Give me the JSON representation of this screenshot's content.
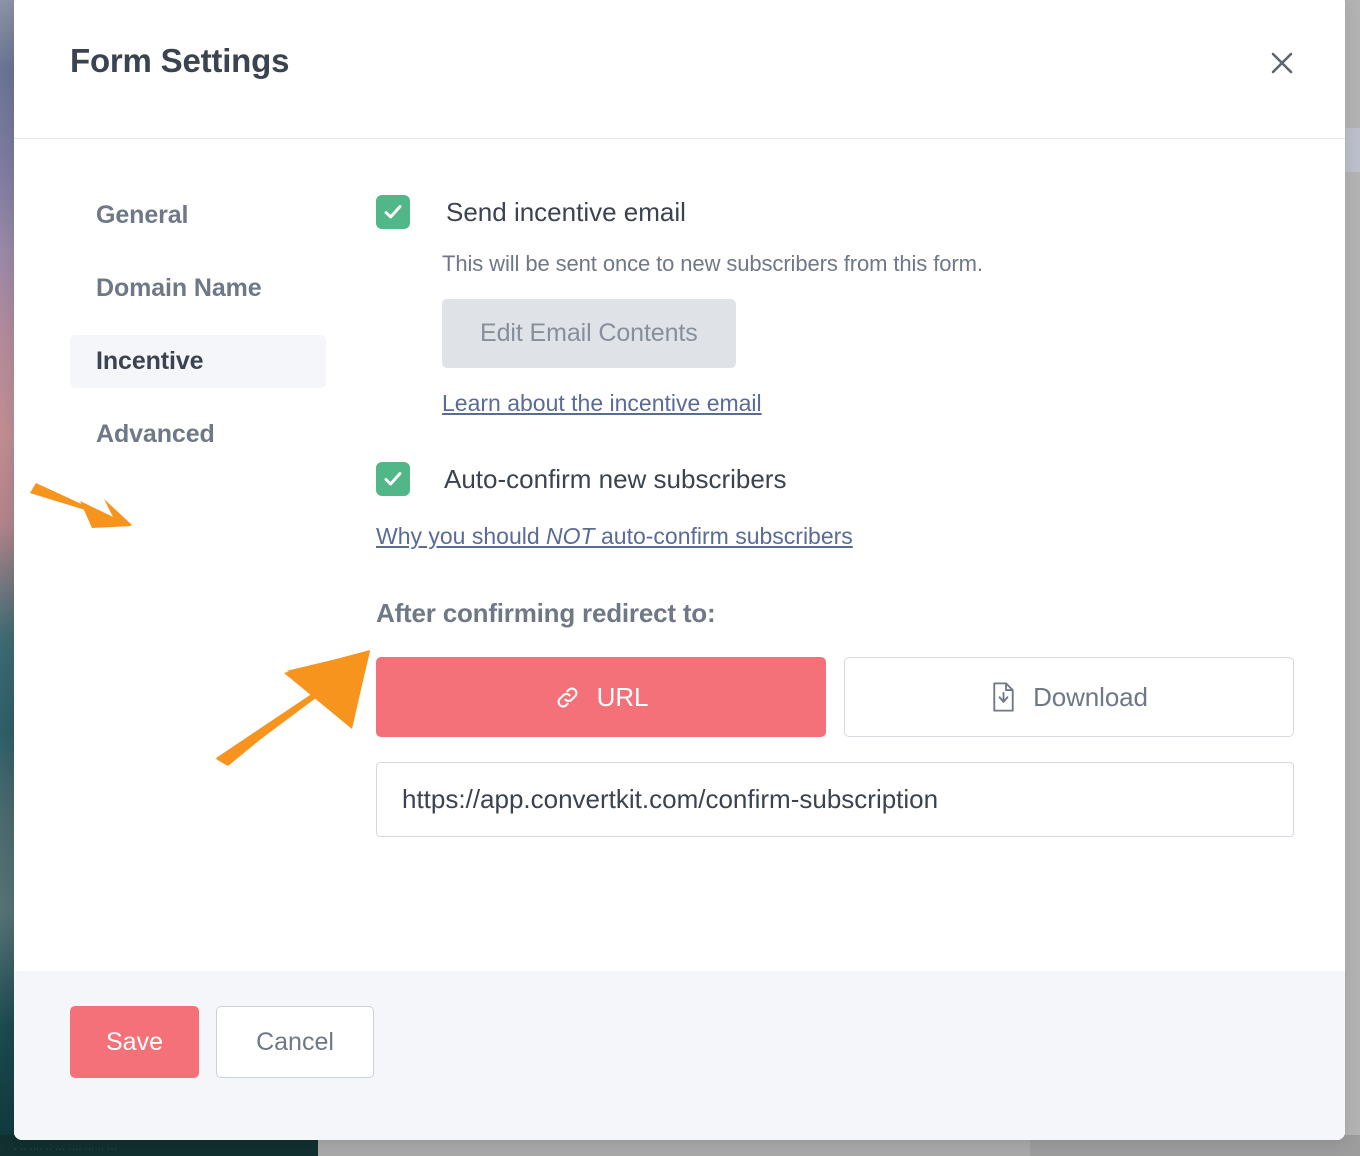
{
  "modal": {
    "title": "Form Settings",
    "close_icon": "close-icon"
  },
  "nav": {
    "items": [
      {
        "label": "General",
        "active": false
      },
      {
        "label": "Domain Name",
        "active": false
      },
      {
        "label": "Incentive",
        "active": true
      },
      {
        "label": "Advanced",
        "active": false
      }
    ]
  },
  "incentive": {
    "send_email": {
      "label": "Send incentive email",
      "checked": true,
      "help_text": "This will be sent once to new subscribers from this form.",
      "edit_button_label": "Edit Email Contents",
      "learn_link_label": "Learn about the incentive email"
    },
    "auto_confirm": {
      "label": "Auto-confirm new subscribers",
      "checked": true,
      "why_link_prefix": "Why you should ",
      "why_link_emphasis": "NOT",
      "why_link_suffix": " auto-confirm subscribers"
    },
    "redirect": {
      "heading": "After confirming redirect to:",
      "options": [
        {
          "label": "URL",
          "icon": "link-icon",
          "selected": true
        },
        {
          "label": "Download",
          "icon": "file-download-icon",
          "selected": false
        }
      ],
      "url_value": "https://app.convertkit.com/confirm-subscription"
    }
  },
  "footer": {
    "save_label": "Save",
    "cancel_label": "Cancel"
  },
  "background": {
    "bottom_bar_text": "· ·· ···· ·· ··· ···· ··· ·· ···",
    "bottom_bar_right_text": "· ·· ··· ···· ·· ···· ··· ···· ·· ··· ···· ·· ···"
  },
  "annotations": {
    "arrow_color": "#f7941e",
    "arrows": [
      {
        "name": "arrow-pointing-to-incentive-tab",
        "direction": "down-right"
      },
      {
        "name": "arrow-pointing-to-auto-confirm-checkbox",
        "direction": "up-right"
      }
    ]
  },
  "colors": {
    "accent_coral": "#f4717a",
    "checkbox_green": "#52b788",
    "link_blue": "#5a6b96",
    "text_dark": "#3b4351",
    "text_muted": "#6f7887",
    "footer_bg": "#f4f6f9"
  }
}
